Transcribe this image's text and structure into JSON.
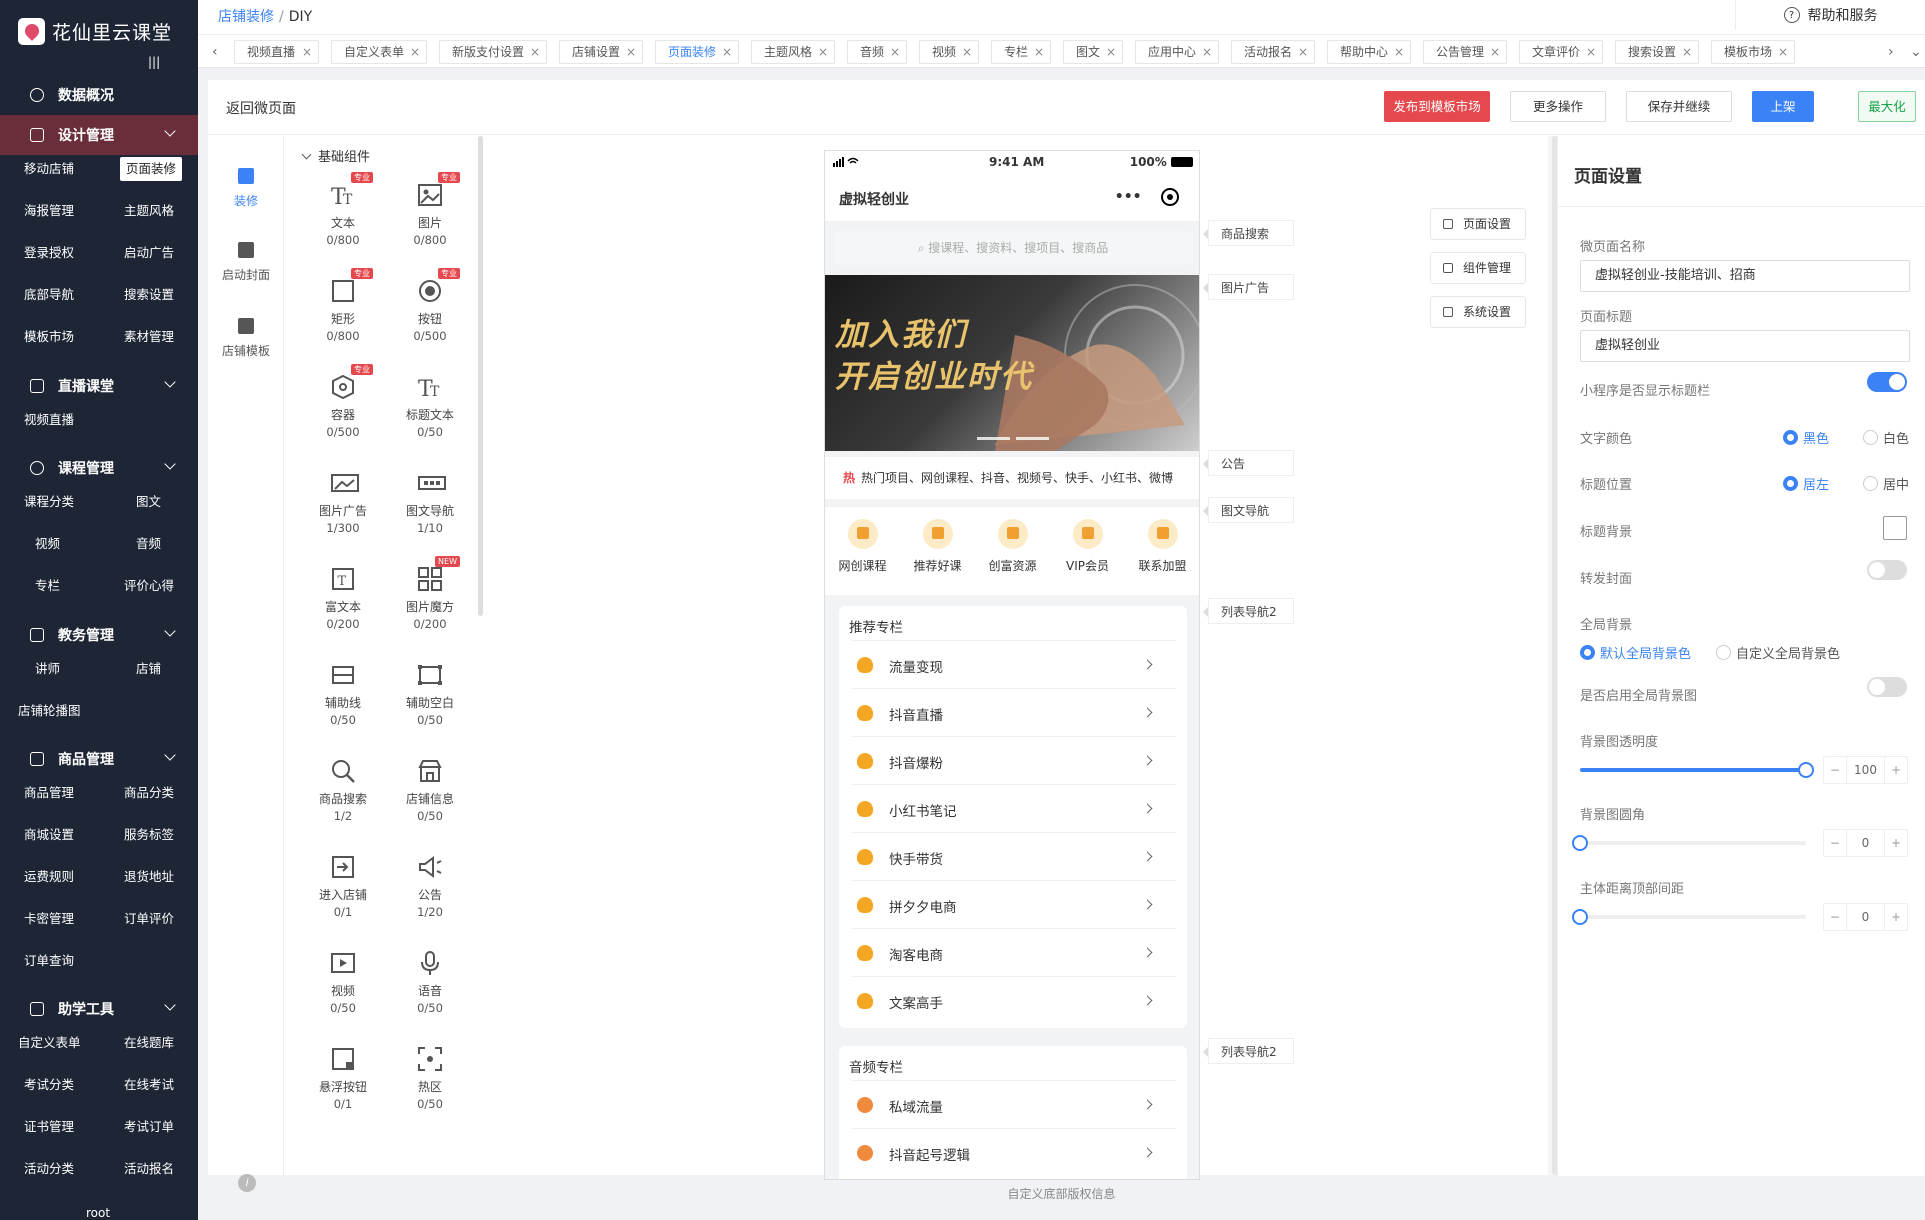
{
  "app": {
    "name": "花仙里云课堂",
    "user": "root",
    "collapse": "|||"
  },
  "colors": {
    "accent": "#3b82f6",
    "danger": "#e5484d",
    "sidebar": "#1e2636",
    "sidebar_active": "#6a2d3a",
    "success": "#16a34a"
  },
  "sidebar": {
    "groups": [
      {
        "label": "数据概况",
        "icon": "clock-icon"
      },
      {
        "label": "设计管理",
        "icon": "design-icon",
        "items": [
          "移动店铺",
          "页面装修",
          "海报管理",
          "主题风格",
          "登录授权",
          "启动广告",
          "底部导航",
          "搜索设置",
          "模板市场",
          "素材管理"
        ]
      },
      {
        "label": "直播课堂",
        "icon": "live-icon",
        "items": [
          "视频直播"
        ]
      },
      {
        "label": "课程管理",
        "icon": "course-icon",
        "items": [
          "课程分类",
          "图文",
          "视频",
          "音频",
          "专栏",
          "评价心得"
        ]
      },
      {
        "label": "教务管理",
        "icon": "calendar-icon",
        "items": [
          "讲师",
          "店铺",
          "店铺轮播图"
        ]
      },
      {
        "label": "商品管理",
        "icon": "goods-icon",
        "items": [
          "商品管理",
          "商品分类",
          "商城设置",
          "服务标签",
          "运费规则",
          "退货地址",
          "卡密管理",
          "订单评价",
          "订单查询"
        ]
      },
      {
        "label": "助学工具",
        "icon": "tools-icon",
        "items": [
          "自定义表单",
          "在线题库",
          "考试分类",
          "在线考试",
          "证书管理",
          "考试订单",
          "活动分类",
          "活动报名"
        ]
      }
    ]
  },
  "header": {
    "breadcrumb": [
      "店铺装修",
      "DIY"
    ],
    "help": "帮助和服务",
    "tabs": [
      "视频直播",
      "自定义表单",
      "新版支付设置",
      "店铺设置",
      "页面装修",
      "主题风格",
      "音频",
      "视频",
      "专栏",
      "图文",
      "应用中心",
      "活动报名",
      "帮助中心",
      "公告管理",
      "文章评价",
      "搜索设置",
      "模板市场"
    ],
    "active_tab": "页面装修"
  },
  "toolbar": {
    "back": "返回微页面",
    "publish": "发布到模板市场",
    "more": "更多操作",
    "save_continue": "保存并继续",
    "online": "上架",
    "maximize": "最大化"
  },
  "vnav": [
    {
      "label": "装修",
      "icon": "brush-icon"
    },
    {
      "label": "启动封面",
      "icon": "cover-icon"
    },
    {
      "label": "店铺模板",
      "icon": "template-icon"
    }
  ],
  "components": {
    "heading": "基础组件",
    "pro_tag": "专业",
    "new_tag": "NEW",
    "items": [
      {
        "label": "文本",
        "count": "0/800",
        "icon": "text-icon"
      },
      {
        "label": "图片",
        "count": "0/800",
        "icon": "image-icon"
      },
      {
        "label": "矩形",
        "count": "0/800",
        "icon": "rect-icon"
      },
      {
        "label": "按钮",
        "count": "0/500",
        "icon": "button-icon"
      },
      {
        "label": "容器",
        "count": "0/500",
        "icon": "container-icon"
      },
      {
        "label": "标题文本",
        "count": "0/50",
        "icon": "title-text-icon"
      },
      {
        "label": "图片广告",
        "count": "1/300",
        "icon": "image-ad-icon"
      },
      {
        "label": "图文导航",
        "count": "1/10",
        "icon": "nav-icon"
      },
      {
        "label": "富文本",
        "count": "0/200",
        "icon": "richtext-icon"
      },
      {
        "label": "图片魔方",
        "count": "0/200",
        "icon": "cube-icon"
      },
      {
        "label": "辅助线",
        "count": "0/50",
        "icon": "line-icon"
      },
      {
        "label": "辅助空白",
        "count": "0/50",
        "icon": "blank-icon"
      },
      {
        "label": "商品搜索",
        "count": "1/2",
        "icon": "search-icon"
      },
      {
        "label": "店铺信息",
        "count": "0/50",
        "icon": "store-icon"
      },
      {
        "label": "进入店铺",
        "count": "0/1",
        "icon": "enter-icon"
      },
      {
        "label": "公告",
        "count": "1/20",
        "icon": "notice-icon"
      },
      {
        "label": "视频",
        "count": "0/50",
        "icon": "video-icon"
      },
      {
        "label": "语音",
        "count": "0/50",
        "icon": "mic-icon"
      },
      {
        "label": "悬浮按钮",
        "count": "0/1",
        "icon": "float-icon"
      },
      {
        "label": "热区",
        "count": "0/50",
        "icon": "hotzone-icon"
      }
    ]
  },
  "phone": {
    "time": "9:41 AM",
    "battery": "100%",
    "title": "虚拟轻创业",
    "search_placeholder": "搜课程、搜资料、搜项目、搜商品",
    "banner_line1": "加入我们",
    "banner_line2": "开启创业时代",
    "notice_hot": "热",
    "notice": "热门项目、网创课程、抖音、视频号、快手、小红书、微博",
    "nav": [
      "网创课程",
      "推荐好课",
      "创富资源",
      "VIP会员",
      "联系加盟"
    ],
    "cards": [
      {
        "title": "推荐专栏",
        "items": [
          "流量变现",
          "抖音直播",
          "抖音爆粉",
          "小红书笔记",
          "快手带货",
          "拼夕夕电商",
          "淘客电商",
          "文案高手"
        ]
      },
      {
        "title": "音频专栏",
        "items": [
          "私域流量",
          "抖音起号逻辑"
        ]
      }
    ]
  },
  "labels": [
    "商品搜索",
    "图片广告",
    "公告",
    "图文导航",
    "列表导航2",
    "列表导航2"
  ],
  "quick_actions": [
    "页面设置",
    "组件管理",
    "系统设置"
  ],
  "settings": {
    "title": "页面设置",
    "page_name_label": "微页面名称",
    "page_name": "虚拟轻创业-技能培训、招商",
    "page_title_label": "页面标题",
    "page_title": "虚拟轻创业",
    "show_titlebar_label": "小程序是否显示标题栏",
    "show_titlebar": true,
    "text_color_label": "文字颜色",
    "text_color_options": [
      "黑色",
      "白色"
    ],
    "title_pos_label": "标题位置",
    "title_pos_options": [
      "居左",
      "居中"
    ],
    "title_bg_label": "标题背景",
    "share_cover_label": "转发封面",
    "share_cover": false,
    "global_bg_label": "全局背景",
    "global_bg_options": [
      "默认全局背景色",
      "自定义全局背景色"
    ],
    "use_bg_image_label": "是否启用全局背景图",
    "use_bg_image": false,
    "bg_opacity_label": "背景图透明度",
    "bg_opacity": 100,
    "bg_radius_label": "背景图圆角",
    "bg_radius": 0,
    "top_margin_label": "主体距离顶部间距",
    "top_margin": 0,
    "step_minus": "−",
    "step_plus": "+"
  },
  "footer": "自定义底部版权信息"
}
